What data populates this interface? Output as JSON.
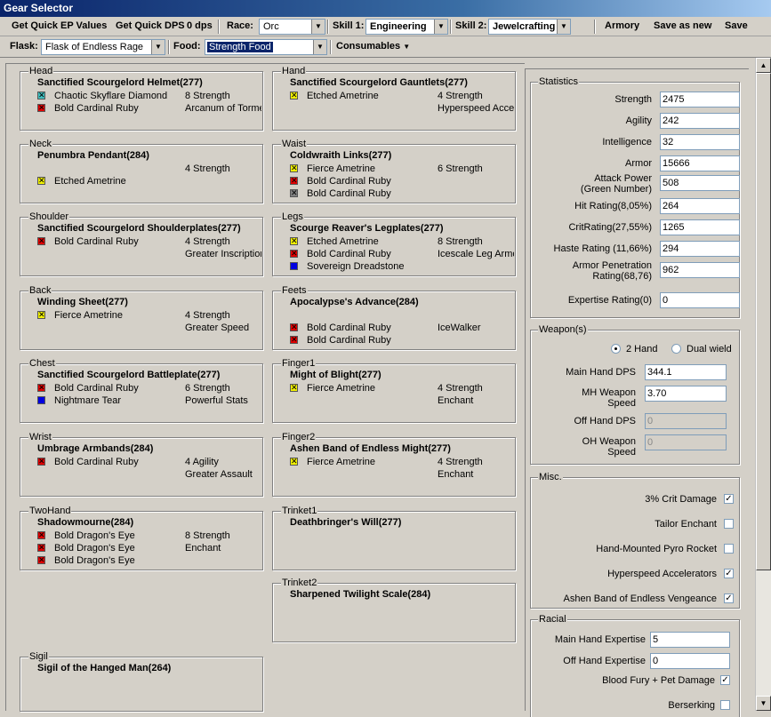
{
  "window": {
    "title": "Gear Selector"
  },
  "toolbar1": {
    "quick_ep": "Get Quick EP Values",
    "quick_dps": "Get Quick DPS",
    "dps_value": "0 dps",
    "race_label": "Race:",
    "race_value": "Orc",
    "skill1_label": "Skill 1:",
    "skill1_value": "Engineering",
    "skill2_label": "Skill 2:",
    "skill2_value": "Jewelcrafting",
    "armory": "Armory",
    "save_as_new": "Save as new",
    "save": "Save"
  },
  "toolbar2": {
    "flask_label": "Flask:",
    "flask_value": "Flask of Endless Rage",
    "food_label": "Food:",
    "food_value": "Strength Food",
    "consumables": "Consumables"
  },
  "gear": {
    "head": {
      "label": "Head",
      "item": "Sanctified Scourgelord Helmet(277)",
      "gems": [
        {
          "name": "Chaotic Skyflare Diamond",
          "color": "#40c0c0",
          "x": true
        },
        {
          "name": "Bold Cardinal Ruby",
          "color": "#e00000",
          "x": true
        }
      ],
      "enchants": [
        "8 Strength",
        "Arcanum of Torment"
      ]
    },
    "hand": {
      "label": "Hand",
      "item": "Sanctified Scourgelord Gauntlets(277)",
      "gems": [
        {
          "name": "Etched Ametrine",
          "color": "#f0f000",
          "x": true
        }
      ],
      "enchants": [
        "4 Strength",
        "Hyperspeed Accelerators"
      ]
    },
    "neck": {
      "label": "Neck",
      "item": "Penumbra Pendant(284)",
      "gems": [
        {
          "name": "",
          "color": "",
          "x": false
        },
        {
          "name": "Etched Ametrine",
          "color": "#f0f000",
          "x": true
        }
      ],
      "enchants": [
        "4 Strength",
        ""
      ]
    },
    "waist": {
      "label": "Waist",
      "item": "Coldwraith Links(277)",
      "gems": [
        {
          "name": "Fierce Ametrine",
          "color": "#f0f000",
          "x": true
        },
        {
          "name": "Bold Cardinal Ruby",
          "color": "#e00000",
          "x": true
        },
        {
          "name": "Bold Cardinal Ruby",
          "color": "#808080",
          "x": true
        }
      ],
      "enchants": [
        "6 Strength",
        ""
      ]
    },
    "shoulder": {
      "label": "Shoulder",
      "item": "Sanctified Scourgelord Shoulderplates(277)",
      "gems": [
        {
          "name": "Bold Cardinal Ruby",
          "color": "#e00000",
          "x": true
        }
      ],
      "enchants": [
        "4 Strength",
        "Greater Inscription of the Axe"
      ]
    },
    "legs": {
      "label": "Legs",
      "item": "Scourge Reaver's Legplates(277)",
      "gems": [
        {
          "name": "Etched Ametrine",
          "color": "#f0f000",
          "x": true
        },
        {
          "name": "Bold Cardinal Ruby",
          "color": "#e00000",
          "x": true
        },
        {
          "name": "Sovereign Dreadstone",
          "color": "#0000e0",
          "x": false
        }
      ],
      "enchants": [
        "8 Strength",
        "Icescale Leg Armor"
      ]
    },
    "back": {
      "label": "Back",
      "item": "Winding Sheet(277)",
      "gems": [
        {
          "name": "Fierce Ametrine",
          "color": "#f0f000",
          "x": true
        }
      ],
      "enchants": [
        "4 Strength",
        "Greater Speed"
      ]
    },
    "feet": {
      "label": "Feets",
      "item": "Apocalypse's Advance(284)",
      "gems": [
        {
          "name": "",
          "color": "",
          "x": false
        },
        {
          "name": "Bold Cardinal Ruby",
          "color": "#e00000",
          "x": true
        },
        {
          "name": "Bold Cardinal Ruby",
          "color": "#e00000",
          "x": true
        }
      ],
      "enchants": [
        "",
        "IceWalker"
      ]
    },
    "chest": {
      "label": "Chest",
      "item": "Sanctified Scourgelord Battleplate(277)",
      "gems": [
        {
          "name": "Bold Cardinal Ruby",
          "color": "#e00000",
          "x": true
        },
        {
          "name": "Nightmare Tear",
          "color": "#0000e0",
          "x": false
        }
      ],
      "enchants": [
        "6 Strength",
        "Powerful Stats"
      ]
    },
    "finger1": {
      "label": "Finger1",
      "item": "Might of Blight(277)",
      "gems": [
        {
          "name": "Fierce Ametrine",
          "color": "#f0f000",
          "x": true
        }
      ],
      "enchants": [
        "4 Strength",
        "Enchant"
      ]
    },
    "wrist": {
      "label": "Wrist",
      "item": "Umbrage Armbands(284)",
      "gems": [
        {
          "name": "Bold Cardinal Ruby",
          "color": "#e00000",
          "x": true
        }
      ],
      "enchants": [
        "4 Agility",
        "Greater Assault"
      ]
    },
    "finger2": {
      "label": "Finger2",
      "item": "Ashen Band of Endless Might(277)",
      "gems": [
        {
          "name": "Fierce Ametrine",
          "color": "#f0f000",
          "x": true
        }
      ],
      "enchants": [
        "4 Strength",
        "Enchant"
      ]
    },
    "twohand": {
      "label": "TwoHand",
      "item": "Shadowmourne(284)",
      "gems": [
        {
          "name": "Bold Dragon's Eye",
          "color": "#e00000",
          "x": true
        },
        {
          "name": "Bold Dragon's Eye",
          "color": "#e00000",
          "x": true
        },
        {
          "name": "Bold Dragon's Eye",
          "color": "#e00000",
          "x": true
        }
      ],
      "enchants": [
        "8 Strength",
        "Enchant"
      ]
    },
    "trinket1": {
      "label": "Trinket1",
      "item": "Deathbringer's Will(277)",
      "gems": [],
      "enchants": []
    },
    "trinket2": {
      "label": "Trinket2",
      "item": "Sharpened Twilight Scale(284)",
      "gems": [],
      "enchants": []
    },
    "sigil": {
      "label": "Sigil",
      "item": "Sigil of the Hanged Man(264)",
      "gems": [],
      "enchants": []
    }
  },
  "statistics": {
    "title": "Statistics",
    "items": [
      {
        "label": "Strength",
        "value": "2475"
      },
      {
        "label": "Agility",
        "value": "242"
      },
      {
        "label": "Intelligence",
        "value": "32"
      },
      {
        "label": "Armor",
        "value": "15666"
      },
      {
        "label": "Attack Power\n(Green Number)",
        "value": "508"
      },
      {
        "label": "Hit Rating(8,05%)",
        "value": "264"
      },
      {
        "label": "CritRating(27,55%)",
        "value": "1265"
      },
      {
        "label": "Haste Rating (11,66%)",
        "value": "294"
      },
      {
        "label": "Armor Penetration\nRating(68,76)",
        "value": "962"
      },
      {
        "label": "Expertise Rating(0)",
        "value": "0"
      }
    ]
  },
  "weapons": {
    "title": "Weapon(s)",
    "two_hand": "2 Hand",
    "dual_wield": "Dual wield",
    "main_dps_label": "Main Hand DPS",
    "main_dps": "344.1",
    "mh_speed_label": "MH Weapon\nSpeed",
    "mh_speed": "3.70",
    "off_dps_label": "Off Hand DPS",
    "off_dps": "0",
    "oh_speed_label": "OH Weapon\nSpeed",
    "oh_speed": "0"
  },
  "misc": {
    "title": "Misc.",
    "items": [
      {
        "label": "3% Crit Damage",
        "checked": true
      },
      {
        "label": "Tailor Enchant",
        "checked": false
      },
      {
        "label": "Hand-Mounted Pyro Rocket",
        "checked": false
      },
      {
        "label": "Hyperspeed Accelerators",
        "checked": true
      },
      {
        "label": "Ashen Band of Endless Vengeance",
        "checked": true
      }
    ]
  },
  "racial": {
    "title": "Racial",
    "mh_expertise_label": "Main Hand Expertise",
    "mh_expertise": "5",
    "oh_expertise_label": "Off Hand Expertise",
    "oh_expertise": "0",
    "blood_fury_label": "Blood Fury + Pet Damage",
    "blood_fury_checked": true,
    "berserking_label": "Berserking",
    "berserking_checked": false
  },
  "icons": {
    "dropdown": "chevron-down-icon",
    "scroll_up": "arrow-up-icon",
    "scroll_down": "arrow-down-icon"
  }
}
